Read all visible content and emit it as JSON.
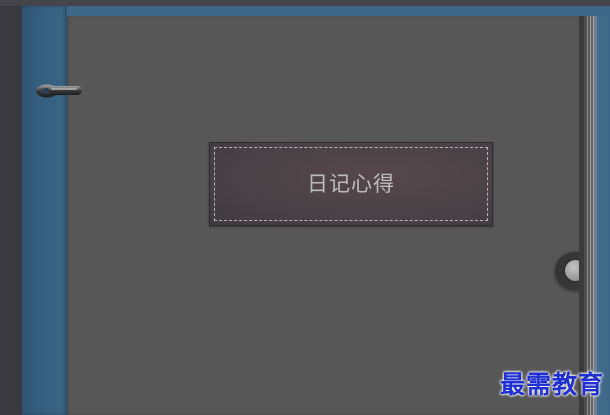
{
  "notebook": {
    "title": "日记心得",
    "ring_icon": "binder-ring-icon",
    "clasp_icon": "clasp-icon"
  },
  "watermark": {
    "text": "最需教育"
  },
  "colors": {
    "spine": "#355e7f",
    "cover": "#575757",
    "label": "#4a4246",
    "watermark": "#1f2fd0"
  }
}
